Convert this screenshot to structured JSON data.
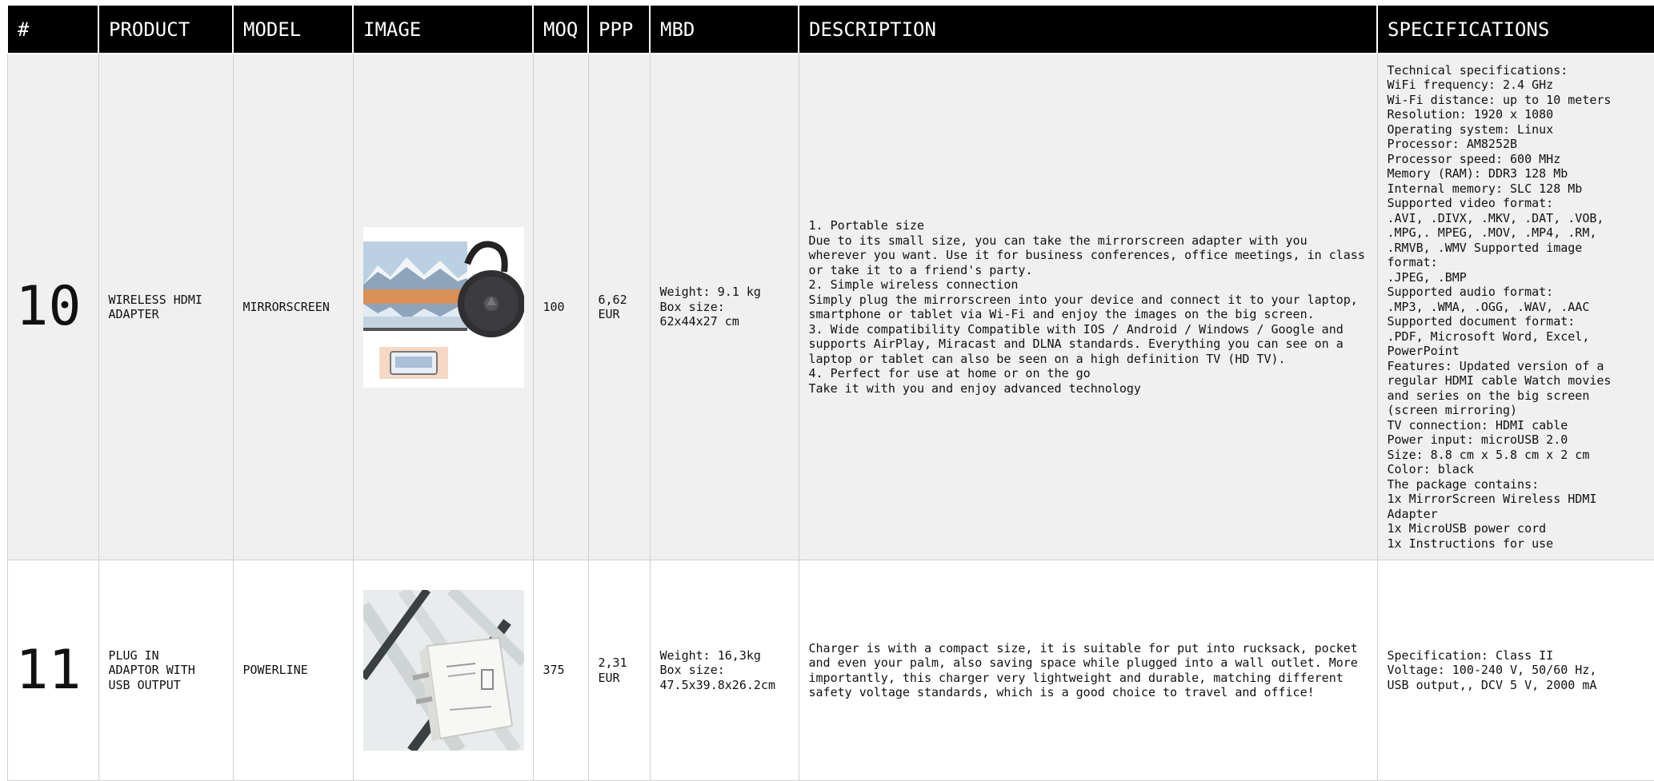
{
  "headers": [
    "#",
    "PRODUCT",
    "MODEL",
    "IMAGE",
    "MOQ",
    "PPP",
    "MBD",
    "DESCRIPTION",
    "SPECIFICATIONS"
  ],
  "rows": [
    {
      "num": "10",
      "product": "WIRELESS HDMI\nADAPTER",
      "model": "MIRRORSCREEN",
      "image": "mirrorscreen-dongle-with-tv-image",
      "moq": "100",
      "ppp": "6,62\nEUR",
      "mbd": "Weight: 9.1 kg\nBox size:\n62x44x27 cm",
      "description": "1. Portable size\nDue to its small size, you can take the mirrorscreen adapter with you wherever you want. Use it for business conferences, office meetings, in class or take it to a friend's party.\n2. Simple wireless connection\nSimply plug the mirrorscreen into your device and connect it to your laptop, smartphone or tablet via Wi-Fi and enjoy the images on the big screen.\n3. Wide compatibility Compatible with IOS / Android / Windows / Google and supports AirPlay, Miracast and DLNA standards. Everything you can see on a laptop or tablet can also be seen on a high definition TV (HD TV).\n4. Perfect for use at home or on the go\nTake it with you and enjoy advanced technology",
      "specifications": "Technical specifications:\nWiFi frequency: 2.4 GHz\nWi-Fi distance: up to 10 meters\nResolution: 1920 x 1080\nOperating system: Linux\nProcessor: AM8252B\nProcessor speed: 600 MHz\nMemory (RAM): DDR3 128 Mb\nInternal memory: SLC 128 Mb\nSupported video format:\n.AVI, .DIVX, .MKV, .DAT, .VOB,\n.MPG,. MPEG, .MOV, .MP4, .RM,\n.RMVB, .WMV Supported image\nformat:\n.JPEG, .BMP\nSupported audio format:\n.MP3, .WMA, .OGG, .WAV, .AAC\nSupported document format:\n.PDF, Microsoft Word, Excel,\nPowerPoint\nFeatures: Updated version of a\nregular HDMI cable Watch movies\nand series on the big screen\n(screen mirroring)\nTV connection: HDMI cable\nPower input: microUSB 2.0\nSize: 8.8 cm x 5.8 cm x 2 cm\nColor: black\nThe package contains:\n1x MirrorScreen Wireless HDMI\nAdapter\n1x MicroUSB power cord\n1x Instructions for use"
    },
    {
      "num": "11",
      "product": "PLUG IN\nADAPTOR WITH\nUSB OUTPUT",
      "model": "POWERLINE",
      "image": "usb-wall-charger-image",
      "moq": "375",
      "ppp": "2,31\nEUR",
      "mbd": "Weight: 16,3kg\nBox size:\n47.5x39.8x26.2cm",
      "description": "Charger is with a compact size, it is suitable for put into rucksack, pocket and even your palm, also saving space while plugged into a wall outlet. More importantly, this charger very lightweight and durable, matching different safety voltage standards, which is a good choice to travel and office!",
      "specifications": "Specification: Class II\nVoltage: 100-240 V, 50/60 Hz,\nUSB output,, DCV 5 V, 2000 mA"
    }
  ]
}
